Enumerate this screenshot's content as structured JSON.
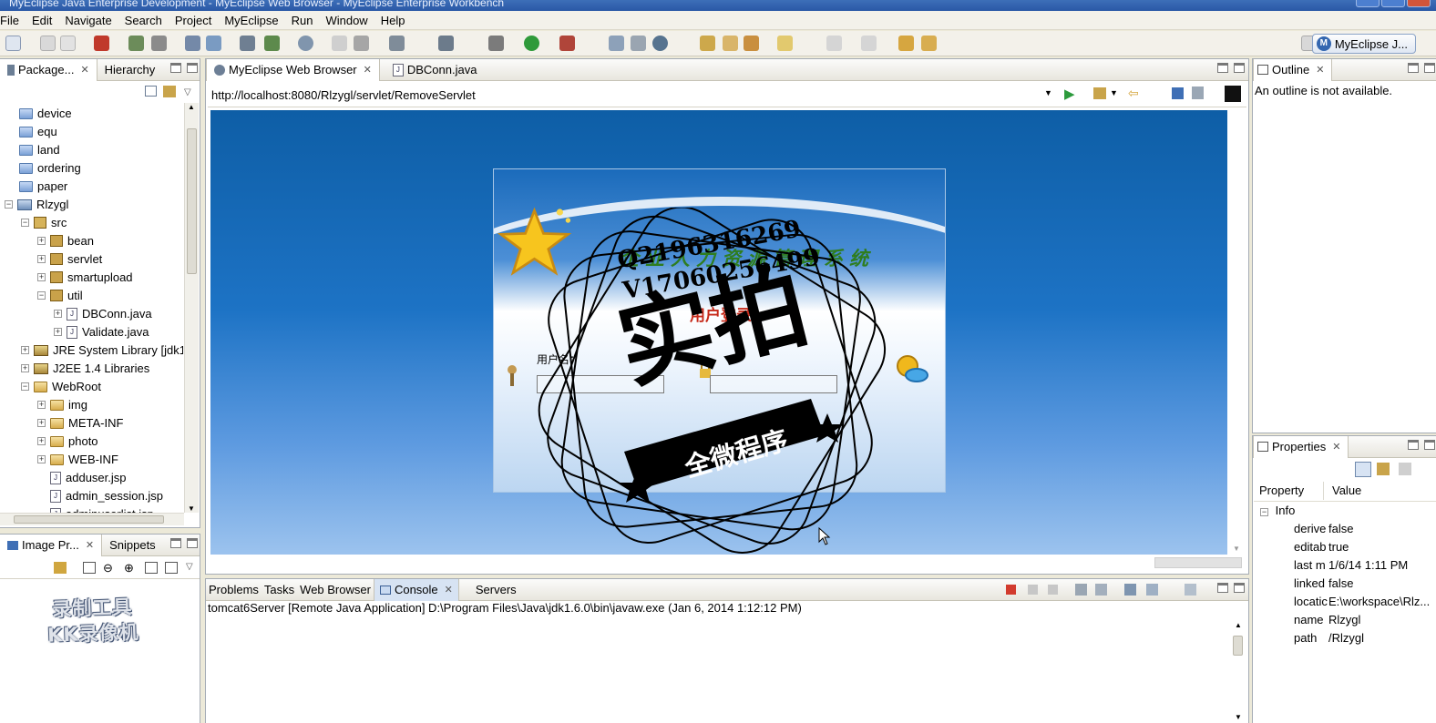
{
  "window": {
    "title": "MyEclipse Java Enterprise Development - MyEclipse Web Browser - MyEclipse Enterprise Workbench"
  },
  "menu": [
    "File",
    "Edit",
    "Navigate",
    "Search",
    "Project",
    "MyEclipse",
    "Run",
    "Window",
    "Help"
  ],
  "perspective": {
    "label": "MyEclipse J..."
  },
  "left_view": {
    "tabs": [
      {
        "label": "Package...",
        "icon": "package-explorer-icon",
        "active": true
      },
      {
        "label": "Hierarchy",
        "icon": "hierarchy-icon",
        "active": false
      }
    ],
    "tree": [
      {
        "label": "device",
        "icon": "folder-icon"
      },
      {
        "label": "equ",
        "icon": "folder-icon"
      },
      {
        "label": "land",
        "icon": "folder-icon"
      },
      {
        "label": "ordering",
        "icon": "folder-icon"
      },
      {
        "label": "paper",
        "icon": "folder-icon"
      },
      {
        "label": "Rlzygl",
        "icon": "project-icon"
      },
      {
        "label": "src",
        "icon": "source-folder-icon"
      },
      {
        "label": "bean",
        "icon": "package-icon"
      },
      {
        "label": "servlet",
        "icon": "package-icon"
      },
      {
        "label": "smartupload",
        "icon": "package-icon"
      },
      {
        "label": "util",
        "icon": "package-icon"
      },
      {
        "label": "DBConn.java",
        "icon": "java-file-icon"
      },
      {
        "label": "Validate.java",
        "icon": "java-file-icon"
      },
      {
        "label": "JRE System Library [jdk1",
        "icon": "library-icon"
      },
      {
        "label": "J2EE 1.4 Libraries",
        "icon": "library-icon"
      },
      {
        "label": "WebRoot",
        "icon": "folder-icon"
      },
      {
        "label": "img",
        "icon": "folder-icon"
      },
      {
        "label": "META-INF",
        "icon": "folder-icon"
      },
      {
        "label": "photo",
        "icon": "folder-icon"
      },
      {
        "label": "WEB-INF",
        "icon": "folder-icon"
      },
      {
        "label": "adduser.jsp",
        "icon": "jsp-file-icon"
      },
      {
        "label": "admin_session.jsp",
        "icon": "jsp-file-icon"
      },
      {
        "label": "adminuserlist.jsp",
        "icon": "jsp-file-icon"
      }
    ]
  },
  "image_view": {
    "tabs": [
      {
        "label": "Image Pr...",
        "active": true
      },
      {
        "label": "Snippets",
        "active": false
      }
    ],
    "recorder_watermark": [
      "录制工具",
      "KK录像机"
    ]
  },
  "editor": {
    "tabs": [
      {
        "label": "MyEclipse Web Browser",
        "icon": "globe-icon",
        "active": true
      },
      {
        "label": "DBConn.java",
        "icon": "java-file-icon",
        "active": false
      }
    ],
    "url": "http://localhost:8080/Rlzygl/servlet/RemoveServlet",
    "page": {
      "system_title": "企业人力资源管理系统",
      "login_heading": "用户登录",
      "user_label": "用户名："
    }
  },
  "watermark": {
    "qq": "Q2196316269",
    "wechat": "V17060256499",
    "big_text": "实拍",
    "ribbon_text": "全微程序"
  },
  "bottom_view": {
    "tabs": [
      {
        "label": "Problems",
        "active": false
      },
      {
        "label": "Tasks",
        "active": false
      },
      {
        "label": "Web Browser",
        "active": false
      },
      {
        "label": "Console",
        "active": true
      },
      {
        "label": "Servers",
        "active": false
      }
    ],
    "console_header": "tomcat6Server [Remote Java Application] D:\\Program Files\\Java\\jdk1.6.0\\bin\\javaw.exe (Jan 6, 2014 1:12:12 PM)"
  },
  "outline_view": {
    "tab": "Outline",
    "message": "An outline is not available."
  },
  "properties_view": {
    "tab": "Properties",
    "headers": [
      "Property",
      "Value"
    ],
    "group": "Info",
    "rows": [
      {
        "prop": "derive",
        "value": "false"
      },
      {
        "prop": "editab",
        "value": "true"
      },
      {
        "prop": "last m",
        "value": "1/6/14 1:11 PM"
      },
      {
        "prop": "linked",
        "value": "false"
      },
      {
        "prop": "locatic",
        "value": "E:\\workspace\\Rlz..."
      },
      {
        "prop": "name",
        "value": "Rlzygl"
      },
      {
        "prop": "path",
        "value": "/Rlzygl"
      }
    ]
  }
}
